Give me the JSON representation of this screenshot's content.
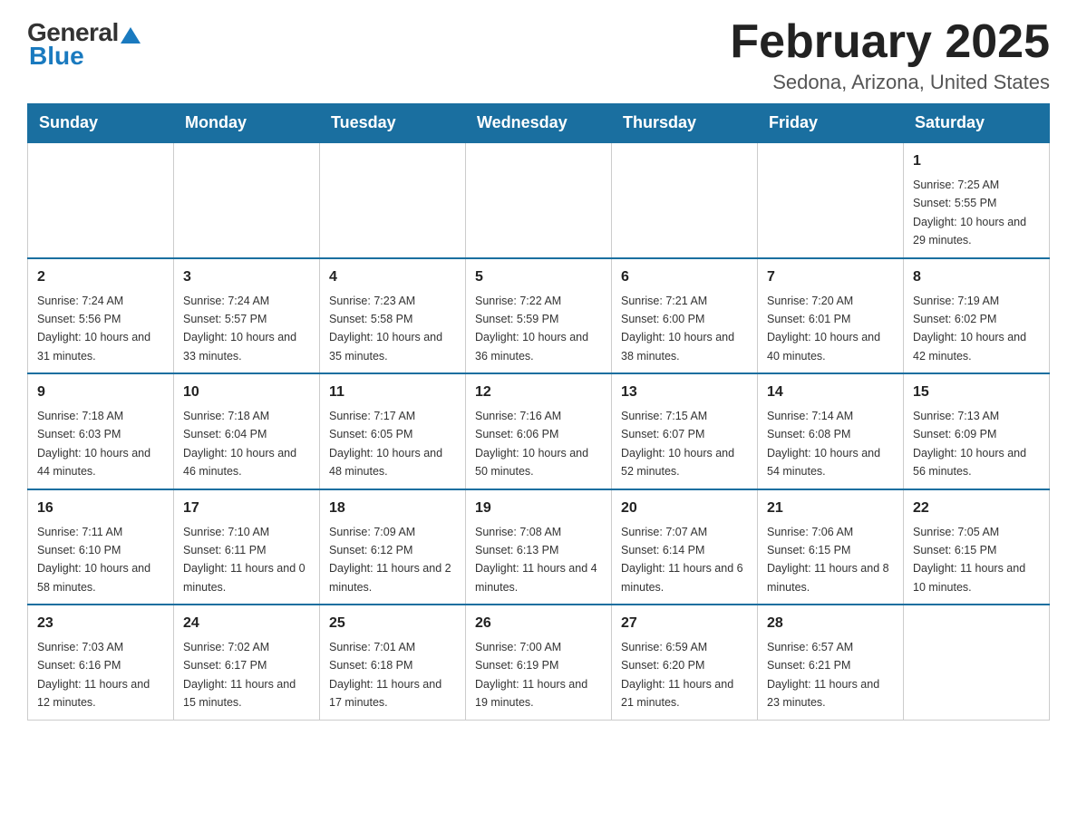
{
  "header": {
    "logo_general": "General",
    "logo_blue": "Blue",
    "title": "February 2025",
    "subtitle": "Sedona, Arizona, United States"
  },
  "days_of_week": [
    "Sunday",
    "Monday",
    "Tuesday",
    "Wednesday",
    "Thursday",
    "Friday",
    "Saturday"
  ],
  "weeks": [
    {
      "days": [
        {
          "date": "",
          "info": ""
        },
        {
          "date": "",
          "info": ""
        },
        {
          "date": "",
          "info": ""
        },
        {
          "date": "",
          "info": ""
        },
        {
          "date": "",
          "info": ""
        },
        {
          "date": "",
          "info": ""
        },
        {
          "date": "1",
          "info": "Sunrise: 7:25 AM\nSunset: 5:55 PM\nDaylight: 10 hours and 29 minutes."
        }
      ]
    },
    {
      "days": [
        {
          "date": "2",
          "info": "Sunrise: 7:24 AM\nSunset: 5:56 PM\nDaylight: 10 hours and 31 minutes."
        },
        {
          "date": "3",
          "info": "Sunrise: 7:24 AM\nSunset: 5:57 PM\nDaylight: 10 hours and 33 minutes."
        },
        {
          "date": "4",
          "info": "Sunrise: 7:23 AM\nSunset: 5:58 PM\nDaylight: 10 hours and 35 minutes."
        },
        {
          "date": "5",
          "info": "Sunrise: 7:22 AM\nSunset: 5:59 PM\nDaylight: 10 hours and 36 minutes."
        },
        {
          "date": "6",
          "info": "Sunrise: 7:21 AM\nSunset: 6:00 PM\nDaylight: 10 hours and 38 minutes."
        },
        {
          "date": "7",
          "info": "Sunrise: 7:20 AM\nSunset: 6:01 PM\nDaylight: 10 hours and 40 minutes."
        },
        {
          "date": "8",
          "info": "Sunrise: 7:19 AM\nSunset: 6:02 PM\nDaylight: 10 hours and 42 minutes."
        }
      ]
    },
    {
      "days": [
        {
          "date": "9",
          "info": "Sunrise: 7:18 AM\nSunset: 6:03 PM\nDaylight: 10 hours and 44 minutes."
        },
        {
          "date": "10",
          "info": "Sunrise: 7:18 AM\nSunset: 6:04 PM\nDaylight: 10 hours and 46 minutes."
        },
        {
          "date": "11",
          "info": "Sunrise: 7:17 AM\nSunset: 6:05 PM\nDaylight: 10 hours and 48 minutes."
        },
        {
          "date": "12",
          "info": "Sunrise: 7:16 AM\nSunset: 6:06 PM\nDaylight: 10 hours and 50 minutes."
        },
        {
          "date": "13",
          "info": "Sunrise: 7:15 AM\nSunset: 6:07 PM\nDaylight: 10 hours and 52 minutes."
        },
        {
          "date": "14",
          "info": "Sunrise: 7:14 AM\nSunset: 6:08 PM\nDaylight: 10 hours and 54 minutes."
        },
        {
          "date": "15",
          "info": "Sunrise: 7:13 AM\nSunset: 6:09 PM\nDaylight: 10 hours and 56 minutes."
        }
      ]
    },
    {
      "days": [
        {
          "date": "16",
          "info": "Sunrise: 7:11 AM\nSunset: 6:10 PM\nDaylight: 10 hours and 58 minutes."
        },
        {
          "date": "17",
          "info": "Sunrise: 7:10 AM\nSunset: 6:11 PM\nDaylight: 11 hours and 0 minutes."
        },
        {
          "date": "18",
          "info": "Sunrise: 7:09 AM\nSunset: 6:12 PM\nDaylight: 11 hours and 2 minutes."
        },
        {
          "date": "19",
          "info": "Sunrise: 7:08 AM\nSunset: 6:13 PM\nDaylight: 11 hours and 4 minutes."
        },
        {
          "date": "20",
          "info": "Sunrise: 7:07 AM\nSunset: 6:14 PM\nDaylight: 11 hours and 6 minutes."
        },
        {
          "date": "21",
          "info": "Sunrise: 7:06 AM\nSunset: 6:15 PM\nDaylight: 11 hours and 8 minutes."
        },
        {
          "date": "22",
          "info": "Sunrise: 7:05 AM\nSunset: 6:15 PM\nDaylight: 11 hours and 10 minutes."
        }
      ]
    },
    {
      "days": [
        {
          "date": "23",
          "info": "Sunrise: 7:03 AM\nSunset: 6:16 PM\nDaylight: 11 hours and 12 minutes."
        },
        {
          "date": "24",
          "info": "Sunrise: 7:02 AM\nSunset: 6:17 PM\nDaylight: 11 hours and 15 minutes."
        },
        {
          "date": "25",
          "info": "Sunrise: 7:01 AM\nSunset: 6:18 PM\nDaylight: 11 hours and 17 minutes."
        },
        {
          "date": "26",
          "info": "Sunrise: 7:00 AM\nSunset: 6:19 PM\nDaylight: 11 hours and 19 minutes."
        },
        {
          "date": "27",
          "info": "Sunrise: 6:59 AM\nSunset: 6:20 PM\nDaylight: 11 hours and 21 minutes."
        },
        {
          "date": "28",
          "info": "Sunrise: 6:57 AM\nSunset: 6:21 PM\nDaylight: 11 hours and 23 minutes."
        },
        {
          "date": "",
          "info": ""
        }
      ]
    }
  ]
}
